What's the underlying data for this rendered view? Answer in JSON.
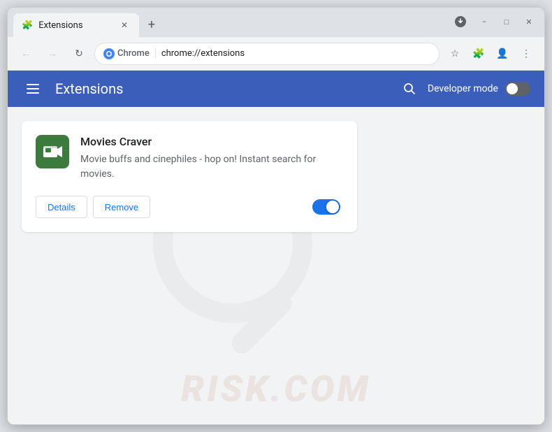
{
  "window": {
    "title": "Extensions",
    "minimize_label": "−",
    "maximize_label": "□",
    "close_label": "✕"
  },
  "tab": {
    "title": "Extensions",
    "new_tab_label": "+"
  },
  "toolbar": {
    "back_label": "←",
    "forward_label": "→",
    "reload_label": "↻",
    "chrome_text": "Chrome",
    "url": "chrome://extensions",
    "star_label": "☆",
    "extensions_icon_label": "🧩",
    "profile_label": "👤",
    "menu_label": "⋮"
  },
  "header": {
    "title": "Extensions",
    "search_label": "🔍",
    "developer_mode_label": "Developer mode"
  },
  "extension": {
    "name": "Movies Craver",
    "description": "Movie buffs and cinephiles - hop on! Instant search for movies.",
    "details_label": "Details",
    "remove_label": "Remove",
    "enabled": true
  },
  "watermark": {
    "text": "RISK.COM"
  }
}
